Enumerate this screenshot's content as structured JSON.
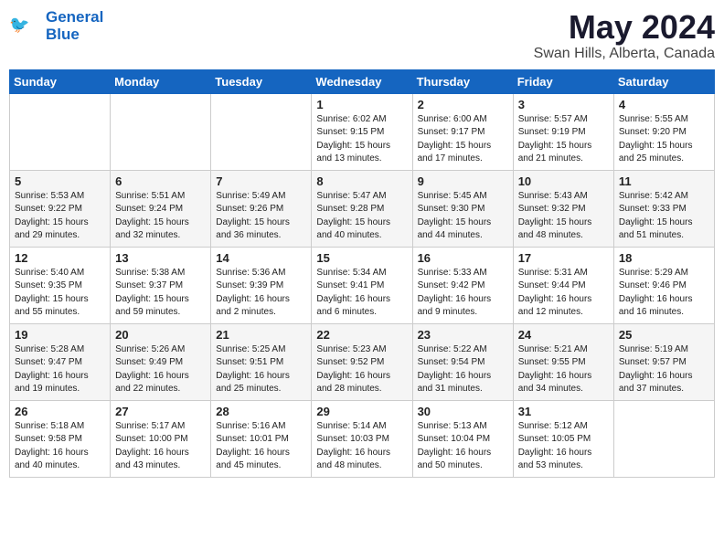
{
  "header": {
    "logo_line1": "General",
    "logo_line2": "Blue",
    "month": "May 2024",
    "location": "Swan Hills, Alberta, Canada"
  },
  "weekdays": [
    "Sunday",
    "Monday",
    "Tuesday",
    "Wednesday",
    "Thursday",
    "Friday",
    "Saturday"
  ],
  "weeks": [
    [
      {
        "day": "",
        "info": ""
      },
      {
        "day": "",
        "info": ""
      },
      {
        "day": "",
        "info": ""
      },
      {
        "day": "1",
        "info": "Sunrise: 6:02 AM\nSunset: 9:15 PM\nDaylight: 15 hours\nand 13 minutes."
      },
      {
        "day": "2",
        "info": "Sunrise: 6:00 AM\nSunset: 9:17 PM\nDaylight: 15 hours\nand 17 minutes."
      },
      {
        "day": "3",
        "info": "Sunrise: 5:57 AM\nSunset: 9:19 PM\nDaylight: 15 hours\nand 21 minutes."
      },
      {
        "day": "4",
        "info": "Sunrise: 5:55 AM\nSunset: 9:20 PM\nDaylight: 15 hours\nand 25 minutes."
      }
    ],
    [
      {
        "day": "5",
        "info": "Sunrise: 5:53 AM\nSunset: 9:22 PM\nDaylight: 15 hours\nand 29 minutes."
      },
      {
        "day": "6",
        "info": "Sunrise: 5:51 AM\nSunset: 9:24 PM\nDaylight: 15 hours\nand 32 minutes."
      },
      {
        "day": "7",
        "info": "Sunrise: 5:49 AM\nSunset: 9:26 PM\nDaylight: 15 hours\nand 36 minutes."
      },
      {
        "day": "8",
        "info": "Sunrise: 5:47 AM\nSunset: 9:28 PM\nDaylight: 15 hours\nand 40 minutes."
      },
      {
        "day": "9",
        "info": "Sunrise: 5:45 AM\nSunset: 9:30 PM\nDaylight: 15 hours\nand 44 minutes."
      },
      {
        "day": "10",
        "info": "Sunrise: 5:43 AM\nSunset: 9:32 PM\nDaylight: 15 hours\nand 48 minutes."
      },
      {
        "day": "11",
        "info": "Sunrise: 5:42 AM\nSunset: 9:33 PM\nDaylight: 15 hours\nand 51 minutes."
      }
    ],
    [
      {
        "day": "12",
        "info": "Sunrise: 5:40 AM\nSunset: 9:35 PM\nDaylight: 15 hours\nand 55 minutes."
      },
      {
        "day": "13",
        "info": "Sunrise: 5:38 AM\nSunset: 9:37 PM\nDaylight: 15 hours\nand 59 minutes."
      },
      {
        "day": "14",
        "info": "Sunrise: 5:36 AM\nSunset: 9:39 PM\nDaylight: 16 hours\nand 2 minutes."
      },
      {
        "day": "15",
        "info": "Sunrise: 5:34 AM\nSunset: 9:41 PM\nDaylight: 16 hours\nand 6 minutes."
      },
      {
        "day": "16",
        "info": "Sunrise: 5:33 AM\nSunset: 9:42 PM\nDaylight: 16 hours\nand 9 minutes."
      },
      {
        "day": "17",
        "info": "Sunrise: 5:31 AM\nSunset: 9:44 PM\nDaylight: 16 hours\nand 12 minutes."
      },
      {
        "day": "18",
        "info": "Sunrise: 5:29 AM\nSunset: 9:46 PM\nDaylight: 16 hours\nand 16 minutes."
      }
    ],
    [
      {
        "day": "19",
        "info": "Sunrise: 5:28 AM\nSunset: 9:47 PM\nDaylight: 16 hours\nand 19 minutes."
      },
      {
        "day": "20",
        "info": "Sunrise: 5:26 AM\nSunset: 9:49 PM\nDaylight: 16 hours\nand 22 minutes."
      },
      {
        "day": "21",
        "info": "Sunrise: 5:25 AM\nSunset: 9:51 PM\nDaylight: 16 hours\nand 25 minutes."
      },
      {
        "day": "22",
        "info": "Sunrise: 5:23 AM\nSunset: 9:52 PM\nDaylight: 16 hours\nand 28 minutes."
      },
      {
        "day": "23",
        "info": "Sunrise: 5:22 AM\nSunset: 9:54 PM\nDaylight: 16 hours\nand 31 minutes."
      },
      {
        "day": "24",
        "info": "Sunrise: 5:21 AM\nSunset: 9:55 PM\nDaylight: 16 hours\nand 34 minutes."
      },
      {
        "day": "25",
        "info": "Sunrise: 5:19 AM\nSunset: 9:57 PM\nDaylight: 16 hours\nand 37 minutes."
      }
    ],
    [
      {
        "day": "26",
        "info": "Sunrise: 5:18 AM\nSunset: 9:58 PM\nDaylight: 16 hours\nand 40 minutes."
      },
      {
        "day": "27",
        "info": "Sunrise: 5:17 AM\nSunset: 10:00 PM\nDaylight: 16 hours\nand 43 minutes."
      },
      {
        "day": "28",
        "info": "Sunrise: 5:16 AM\nSunset: 10:01 PM\nDaylight: 16 hours\nand 45 minutes."
      },
      {
        "day": "29",
        "info": "Sunrise: 5:14 AM\nSunset: 10:03 PM\nDaylight: 16 hours\nand 48 minutes."
      },
      {
        "day": "30",
        "info": "Sunrise: 5:13 AM\nSunset: 10:04 PM\nDaylight: 16 hours\nand 50 minutes."
      },
      {
        "day": "31",
        "info": "Sunrise: 5:12 AM\nSunset: 10:05 PM\nDaylight: 16 hours\nand 53 minutes."
      },
      {
        "day": "",
        "info": ""
      }
    ]
  ]
}
